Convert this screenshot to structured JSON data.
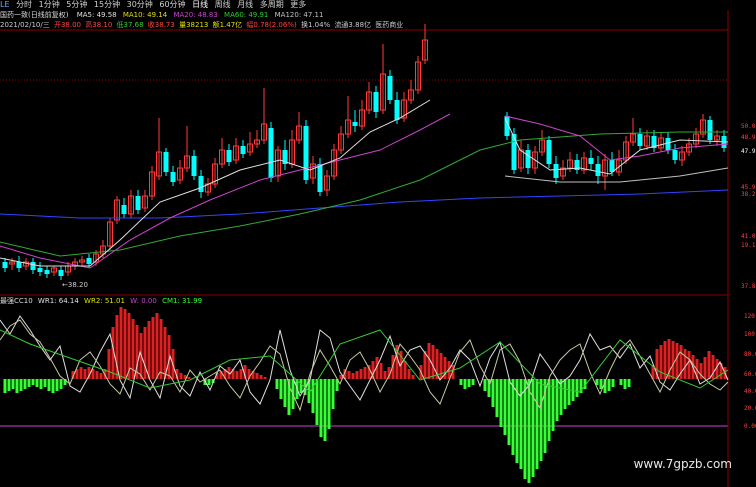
{
  "topbar": {
    "code_box": "LE",
    "tabs": [
      "分时",
      "1分钟",
      "5分钟",
      "15分钟",
      "30分钟",
      "60分钟",
      "日线",
      "周线",
      "月线",
      "多周期",
      "更多"
    ]
  },
  "info1": {
    "stock": "国药一致(日线前复权)",
    "ma5": "MA5: 49.58",
    "ma10": "MA10: 49.14",
    "ma20": "MA20: 48.83",
    "ma60": "MA60: 49.91",
    "ma120": "MA120: 47.11"
  },
  "info2": {
    "date": "2021/02/10/三",
    "open": "开38.00",
    "high": "高38.10",
    "low": "低37.68",
    "close": "收38.73",
    "volume": "量38213",
    "amount": "额1.47亿",
    "change": "幅0.78(2.06%)",
    "turnover": "换1.04%",
    "float": "流通3.88亿",
    "sector": "医药商业"
  },
  "indicator": {
    "name": "最强CC10",
    "wr1": "WR1: 64.14",
    "wr2": "WR2: 51.01",
    "w": "W: 0.00",
    "cm1": "CM1: 31.99"
  },
  "price_axis": [
    "50.0",
    "48.9",
    "47.91",
    "45.9",
    "38.2",
    "41.0",
    "19.1",
    "37.8"
  ],
  "indicator_axis": [
    "120.00",
    "100.00",
    "80.00",
    "60.00",
    "40.00",
    "20.00",
    "0.00"
  ],
  "low_label": "←38.20",
  "watermark": "www.7gpzb.com",
  "colors": {
    "up": "#ff3b3b",
    "down": "#00ffff",
    "green_bar": "#33ff33",
    "red_bar": "#e02020",
    "grid": "#8b0000",
    "ma_white": "#e0e0e0",
    "ma_magenta": "#cc44cc",
    "ma_green": "#33aa33",
    "ma_blue": "#3344ff"
  }
}
